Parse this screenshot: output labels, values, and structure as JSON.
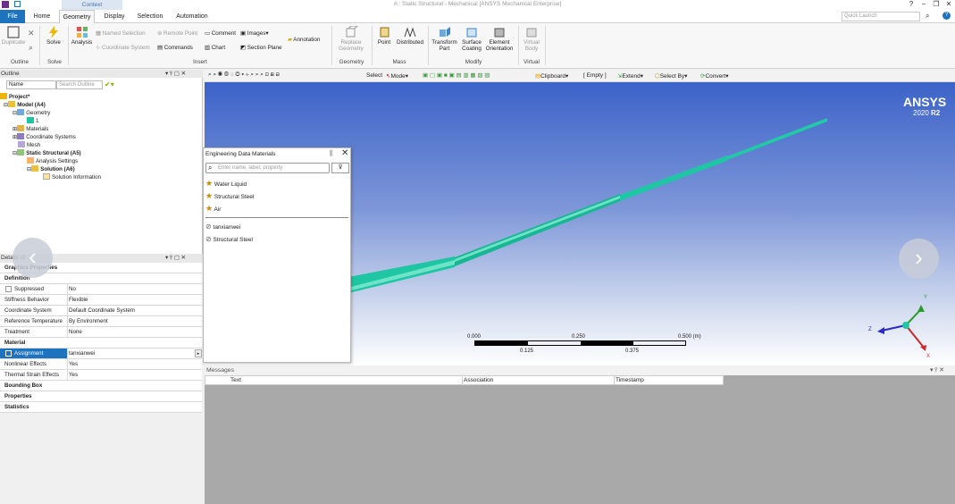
{
  "window": {
    "title": "A : Static Structural - Mechanical [ANSYS Mechanical Enterprise]",
    "context_tab": "Context",
    "controls": [
      "?",
      "−",
      "❐",
      "✕"
    ]
  },
  "ribbon_tabs": [
    "File",
    "Home",
    "Geometry",
    "Display",
    "Selection",
    "Automation"
  ],
  "quick_launch": {
    "placeholder": "Quick Launch"
  },
  "ribbon": {
    "outline": {
      "duplicate": "Duplicate",
      "label": "Outline"
    },
    "solve": {
      "solve": "Solve",
      "label": "Solve"
    },
    "insert": {
      "analysis": "Analysis",
      "named_selection": "Named Selection",
      "coordinate_system": "Coordinate System",
      "remote_point": "Remote Point",
      "commands": "Commands",
      "comment": "Comment",
      "chart": "Chart",
      "images": "Images",
      "section_plane": "Section Plane",
      "annotation": "Annotation",
      "label": "Insert"
    },
    "geometry": {
      "replace": "Replace",
      "replace2": "Geometry",
      "label": "Geometry"
    },
    "mass": {
      "point": "Point",
      "distributed": "Distributed",
      "label": "Mass"
    },
    "modify": {
      "transform": "Transform",
      "transform2": "Part",
      "surface": "Surface",
      "surface2": "Coating",
      "element": "Element",
      "element2": "Orientation",
      "label": "Modify"
    },
    "virtual": {
      "vb1": "Virtual",
      "vb2": "Body",
      "label": "Virtual"
    }
  },
  "outline": {
    "title": "Outline",
    "filter_label": "Name",
    "search_placeholder": "Search Outline",
    "tree": {
      "project": "Project*",
      "model": "Model (A4)",
      "geometry": "Geometry",
      "body": "1",
      "materials": "Materials",
      "coordinate_systems": "Coordinate Systems",
      "mesh": "Mesh",
      "static_structural": "Static Structural (A5)",
      "analysis_settings": "Analysis Settings",
      "solution": "Solution (A6)",
      "solution_information": "Solution Information"
    }
  },
  "details": {
    "title": "Details of",
    "rows": {
      "graphics_properties": "Graphics Properties",
      "definition": "Definition",
      "suppressed_k": "Suppressed",
      "suppressed_v": "No",
      "stiffness_k": "Stiffness Behavior",
      "stiffness_v": "Flexible",
      "coord_k": "Coordinate System",
      "coord_v": "Default Coordinate System",
      "reftemp_k": "Reference Temperature",
      "reftemp_v": "By Environment",
      "treatment_k": "Treatment",
      "treatment_v": "None",
      "material": "Material",
      "assignment_k": "Assignment",
      "assignment_v": "tanxianwei",
      "nonlinear_k": "Nonlinear Effects",
      "nonlinear_v": "Yes",
      "thermal_k": "Thermal Strain Effects",
      "thermal_v": "Yes",
      "bounding_box": "Bounding Box",
      "properties": "Properties",
      "statistics": "Statistics"
    }
  },
  "graphics_toolbar": {
    "select": "Select",
    "mode": "Mode",
    "clipboard": "Clipboard",
    "empty": "[ Empty ]",
    "extend": "Extend",
    "select_by": "Select By",
    "convert": "Convert"
  },
  "viewport": {
    "brand": "ANSYS",
    "version": "2020",
    "version_suffix": "R2",
    "scale": {
      "t0": "0.000",
      "t1": "0.250",
      "t2": "0.500 (m)",
      "b1": "0.125",
      "b2": "0.375"
    },
    "triad": {
      "x": "X",
      "y": "Y",
      "z": "Z"
    }
  },
  "engineering_data": {
    "title": "Engineering Data Materials",
    "search_placeholder": "Enter name, label, property",
    "favorites": [
      "Water Liquid",
      "Structural Steel",
      "Air"
    ],
    "model_materials": [
      "tanxianwei",
      "Structural Steel"
    ]
  },
  "messages": {
    "title": "Messages",
    "columns": [
      "Text",
      "Association",
      "Timestamp"
    ]
  },
  "colors": {
    "accent": "#1e73be",
    "model": "#1fc6a3"
  }
}
